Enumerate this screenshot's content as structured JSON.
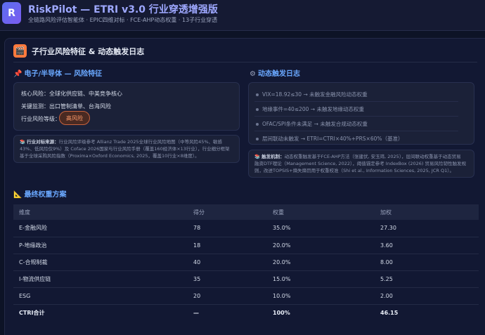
{
  "header": {
    "logo_letter": "R",
    "title": "RiskPilot — ETRI v3.0 行业穿透增强版",
    "subtitle": "全链路风险评估智能体 · EPIC四维对标 · FCE-AHP动态权重 · 13子行业穿透"
  },
  "panel": {
    "icon_glyph": "🎬",
    "title": "子行业风险特征 & 动态触发日志"
  },
  "left": {
    "icon_glyph": "📌",
    "heading": "电子/半导体 — 风险特征",
    "rows": [
      {
        "label": "核心风险：",
        "value": "全球化供应链、中美竞争核心"
      },
      {
        "label": "关键监测：",
        "value": "出口管制清单、台海风险"
      },
      {
        "label": "行业风险等级：",
        "value": ""
      }
    ],
    "badge": "高风险",
    "note_icon": "📚",
    "note_label": "行业对标来源：",
    "note_lines": [
      "行业风险评级参考 Allianz Trade 2025全球行业风险地图（中等风险45%、敏感",
      "43%、低风险仅9%）及 Coface 2026国家与行业风险手册（覆盖160经济体×13行业），行业细分框架",
      "基于全球采购风险指数（Proxima×Oxford Economics, 2025，覆盖10行业×8维度）。"
    ]
  },
  "right": {
    "icon_glyph": "⚙",
    "heading": "动态触发日志",
    "triggers": [
      "VIX=18.92≤30 → 未触发金融风险动态权重",
      "地缘事件=40≤200 → 未触发地缘动态权重",
      "OFAC/SPI条件未满足 → 未触发合规动态权重",
      "层间联动未触发 → ETRI=CTRI×40%+PRS×60%（基准）"
    ],
    "note_icon": "📚",
    "note_label": "触发机制：",
    "note_lines": [
      "动态权重触发基于FCE-AHP方法（张建伏, 安玉玮, 2025），层间联动权重基于动态贸易",
      "融资DTF理论（Management Science, 2022），阈值锚定参考 IndexBox (2026) 贸易风险韧性触发规",
      "则，改进TOPSIS+熵失熵罚用于权重校准（Shi et al., Information Sciences, 2025, JCR Q1）。"
    ]
  },
  "weights": {
    "icon_glyph": "📐",
    "heading": "最终权重方案",
    "columns": [
      "维度",
      "得分",
      "权重",
      "加权"
    ],
    "rows": [
      [
        "E-金融风险",
        "78",
        "35.0%",
        "27.30"
      ],
      [
        "P-地缘政治",
        "18",
        "20.0%",
        "3.60"
      ],
      [
        "C-合规制裁",
        "40",
        "20.0%",
        "8.00"
      ],
      [
        "I-物流供应链",
        "35",
        "15.0%",
        "5.25"
      ],
      [
        "ESG",
        "20",
        "10.0%",
        "2.00"
      ],
      [
        "CTRI合计",
        "—",
        "100%",
        "46.15"
      ]
    ]
  }
}
